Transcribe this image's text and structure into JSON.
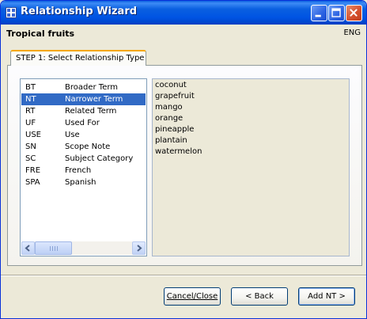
{
  "window": {
    "title": "Relationship Wizard"
  },
  "header": {
    "title": "Tropical fruits",
    "language": "ENG"
  },
  "step_tab": {
    "label": "STEP 1: Select Relationship Type"
  },
  "relationship_types": [
    {
      "code": "BT",
      "name": "Broader Term",
      "selected": false
    },
    {
      "code": "NT",
      "name": "Narrower Term",
      "selected": true
    },
    {
      "code": "RT",
      "name": "Related Term",
      "selected": false
    },
    {
      "code": "UF",
      "name": "Used For",
      "selected": false
    },
    {
      "code": "USE",
      "name": "Use",
      "selected": false
    },
    {
      "code": "SN",
      "name": "Scope Note",
      "selected": false
    },
    {
      "code": "SC",
      "name": "Subject Category",
      "selected": false
    },
    {
      "code": "FRE",
      "name": "French",
      "selected": false
    },
    {
      "code": "SPA",
      "name": "Spanish",
      "selected": false
    }
  ],
  "related_items": [
    "coconut",
    "grapefruit",
    "mango",
    "orange",
    "pineapple",
    "plantain",
    "watermelon"
  ],
  "buttons": {
    "cancel": "Cancel/Close",
    "back": "< Back",
    "add": "Add NT >"
  },
  "icons": {
    "app": "app-grid-icon",
    "minimize": "minimize-icon",
    "maximize": "maximize-icon",
    "close": "close-icon",
    "scroll_left": "arrow-left-icon",
    "scroll_right": "arrow-right-icon"
  },
  "colors": {
    "titlebar": "#0054e3",
    "selection": "#316ac5",
    "tab_accent": "#f5a700",
    "close_button": "#d5512e"
  }
}
